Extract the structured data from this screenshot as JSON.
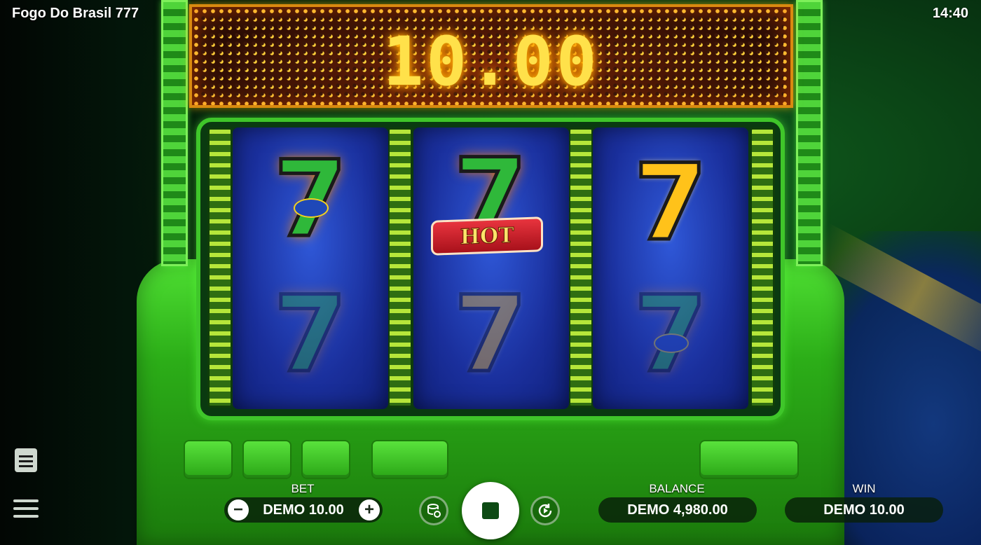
{
  "app": {
    "title": "Fogo Do Brasil 777",
    "clock": "14:40"
  },
  "marquee": {
    "win_display": "10.00"
  },
  "reels": [
    {
      "top": "flag-seven",
      "bottom": "flag-seven"
    },
    {
      "top": "hot-seven",
      "bottom": "gold-seven"
    },
    {
      "top": "gold-seven",
      "bottom": "flag-seven"
    }
  ],
  "hot_badge": "HOT",
  "hud": {
    "bet_label": "BET",
    "bet_value": "DEMO 10.00",
    "minus": "−",
    "plus": "+",
    "balance_label": "BALANCE",
    "balance_value": "DEMO 4,980.00",
    "win_label": "WIN",
    "win_value": "DEMO 10.00"
  },
  "icons": {
    "menu": "hamburger-icon",
    "history": "history-icon",
    "spin": "stop-icon",
    "coins": "coins-settings-icon",
    "autoplay": "autoplay-icon"
  },
  "colors": {
    "accent_green": "#3fc62a",
    "marquee_gold": "#ffe14a",
    "reel_blue": "#1a2f9c"
  }
}
